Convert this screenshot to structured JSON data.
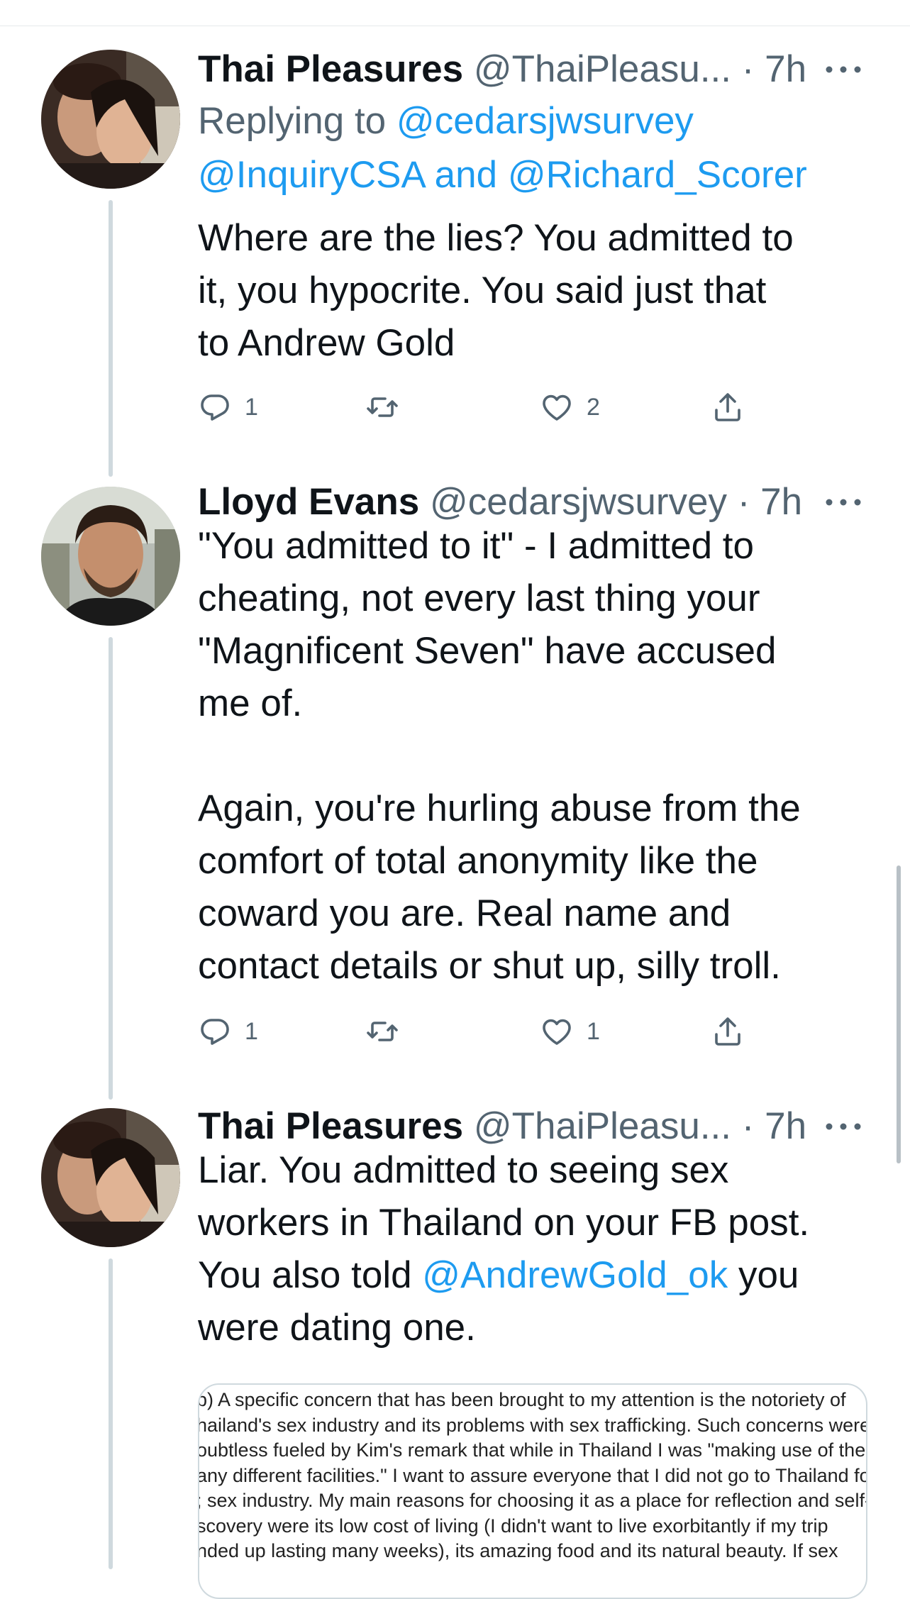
{
  "tweets": [
    {
      "name": "Thai Pleasures",
      "handle": "@ThaiPleasu...",
      "dot": "·",
      "time": "7h",
      "replying_prefix": "Replying to ",
      "replying_link1": "@cedarsjwsurvey",
      "replying_link2": "@InquiryCSA",
      "replying_and": " and ",
      "replying_link3": "@Richard_Scorer",
      "text_lines": [
        "Where are the lies?  You admitted to",
        "it, you hypocrite. You said just that",
        "to Andrew Gold"
      ],
      "reply_count": "1",
      "retweet_count": "",
      "like_count": "2"
    },
    {
      "name": "Lloyd Evans",
      "handle": "@cedarsjwsurvey",
      "dot": "·",
      "time": "7h",
      "text_lines": [
        "\"You admitted to it\" - I admitted to",
        "cheating, not every last thing your",
        "\"Magnificent Seven\" have accused",
        "me of.",
        "",
        "Again, you're hurling abuse from the",
        "comfort of total anonymity like the",
        "coward you are. Real name and",
        "contact details or shut up, silly troll."
      ],
      "reply_count": "1",
      "retweet_count": "",
      "like_count": "1"
    },
    {
      "name": "Thai Pleasures",
      "handle": "@ThaiPleasu...",
      "dot": "·",
      "time": "7h",
      "text_line1": "Liar.  You admitted to seeing sex",
      "text_line2": "workers in Thailand on your FB post.",
      "text_line3_pre": "You also told ",
      "text_line3_link": "@AndrewGold_ok",
      "text_line3_post": " you",
      "text_line4": "were dating one.",
      "attachment_lines": [
        "b) A specific concern that has been brought to my attention is the notoriety of",
        "hailand's sex industry and its problems with sex trafficking. Such concerns were",
        "oubtless fueled by Kim's remark that while in Thailand I was \"making use of the",
        "any different facilities.\" I want to assure everyone that I did not go to Thailand fo",
        "; sex industry. My main reasons for choosing it as a place for reflection and self-",
        "scovery were its low cost of living (I didn't want to live exorbitantly if my trip",
        "nded up lasting many weeks), its amazing food and its natural beauty. If sex"
      ]
    }
  ],
  "icons": {
    "reply": "reply-icon",
    "retweet": "retweet-icon",
    "like": "like-icon",
    "share": "share-icon",
    "more": "more-icon"
  },
  "colors": {
    "link": "#1d9bf0",
    "secondary": "#536471",
    "thread_line": "#cfd9de"
  }
}
